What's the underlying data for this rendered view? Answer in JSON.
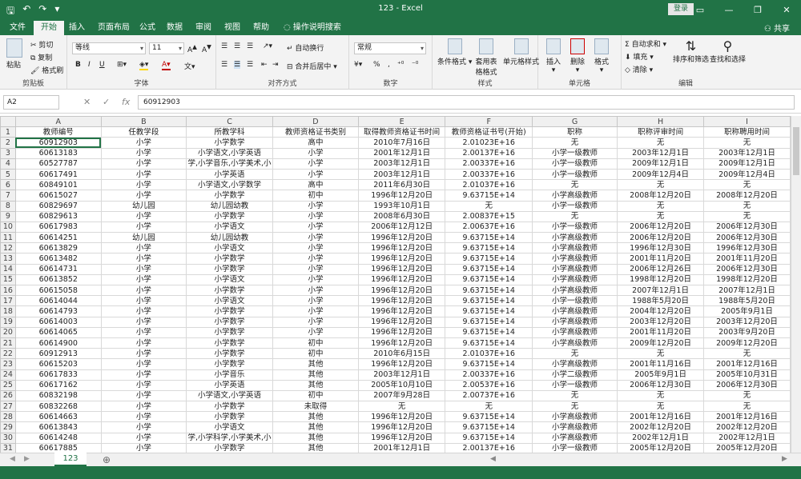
{
  "window": {
    "title": "123  -  Excel",
    "login": "登录",
    "file_tab": "文件"
  },
  "tabs": [
    "开始",
    "插入",
    "页面布局",
    "公式",
    "数据",
    "审阅",
    "视图",
    "帮助",
    "操作说明搜索"
  ],
  "share": "共享",
  "ribbon": {
    "clipboard": {
      "label": "剪贴板",
      "paste": "粘贴",
      "cut": "剪切",
      "copy": "复制",
      "format_painter": "格式刷"
    },
    "font": {
      "label": "字体",
      "name": "等线",
      "size": "11"
    },
    "alignment": {
      "label": "对齐方式",
      "wrap": "自动换行",
      "merge": "合并后居中"
    },
    "number": {
      "label": "数字",
      "format": "常规"
    },
    "styles": {
      "label": "样式",
      "conditional": "条件格式",
      "table_format": "套用表格格式",
      "cell_styles": "单元格样式"
    },
    "cells": {
      "label": "单元格",
      "insert": "插入",
      "delete": "删除",
      "format": "格式"
    },
    "editing": {
      "label": "编辑",
      "autosum": "自动求和",
      "fill": "填充",
      "clear": "清除",
      "sort": "排序和筛选",
      "find": "查找和选择"
    }
  },
  "formula_bar": {
    "name_box": "A2",
    "cancel": "✕",
    "enter": "✓",
    "fx": "fx",
    "value": "60912903"
  },
  "columns": [
    "A",
    "B",
    "C",
    "D",
    "E",
    "F",
    "G",
    "H",
    "I"
  ],
  "rows": [
    [
      "教师编号",
      "任教学段",
      "所教学科",
      "教师资格证书类别",
      "取得教师资格证书时间",
      "教师资格证书号(开始)",
      "职称",
      "职称评审时间",
      "职称聘用时间"
    ],
    [
      "60912903",
      "小学",
      "小学数学",
      "高中",
      "2010年7月16日",
      "2.01023E+16",
      "无",
      "无",
      "无"
    ],
    [
      "60613183",
      "小学",
      "小学语文,小学英语",
      "小学",
      "2001年12月1日",
      "2.00137E+16",
      "小学一级教师",
      "2003年12月1日",
      "2003年12月1日"
    ],
    [
      "60527787",
      "小学",
      "学,小学音乐,小学美术,小",
      "小学",
      "2003年12月1日",
      "2.00337E+16",
      "小学一级教师",
      "2009年12月1日",
      "2009年12月1日"
    ],
    [
      "60617491",
      "小学",
      "小学英语",
      "小学",
      "2003年12月1日",
      "2.00337E+16",
      "小学一级教师",
      "2009年12月4日",
      "2009年12月4日"
    ],
    [
      "60849101",
      "小学",
      "小学语文,小学数学",
      "高中",
      "2011年6月30日",
      "2.01037E+16",
      "无",
      "无",
      "无"
    ],
    [
      "60615027",
      "小学",
      "小学数学",
      "初中",
      "1996年12月20日",
      "9.63715E+14",
      "小学高级教师",
      "2008年12月20日",
      "2008年12月20日"
    ],
    [
      "60829697",
      "幼儿园",
      "幼儿园幼教",
      "小学",
      "1993年10月1日",
      "无",
      "小学一级教师",
      "无",
      "无"
    ],
    [
      "60829613",
      "小学",
      "小学数学",
      "小学",
      "2008年6月30日",
      "2.00837E+15",
      "无",
      "无",
      "无"
    ],
    [
      "60617983",
      "小学",
      "小学语文",
      "小学",
      "2006年12月12日",
      "2.00637E+16",
      "小学一级教师",
      "2006年12月20日",
      "2006年12月30日"
    ],
    [
      "60614251",
      "幼儿园",
      "幼儿园幼教",
      "小学",
      "1996年12月20日",
      "9.63715E+14",
      "小学高级教师",
      "2006年12月20日",
      "2006年12月30日"
    ],
    [
      "60613829",
      "小学",
      "小学语文",
      "小学",
      "1996年12月20日",
      "9.63715E+14",
      "小学高级教师",
      "1996年12月30日",
      "1996年12月30日"
    ],
    [
      "60613482",
      "小学",
      "小学数学",
      "小学",
      "1996年12月20日",
      "9.63715E+14",
      "小学高级教师",
      "2001年11月20日",
      "2001年11月20日"
    ],
    [
      "60614731",
      "小学",
      "小学数学",
      "小学",
      "1996年12月20日",
      "9.63715E+14",
      "小学高级教师",
      "2006年12月26日",
      "2006年12月30日"
    ],
    [
      "60613852",
      "小学",
      "小学语文",
      "小学",
      "1996年12月20日",
      "9.63715E+14",
      "小学高级教师",
      "1998年12月20日",
      "1998年12月20日"
    ],
    [
      "60615058",
      "小学",
      "小学数学",
      "小学",
      "1996年12月20日",
      "9.63715E+14",
      "小学高级教师",
      "2007年12月1日",
      "2007年12月1日"
    ],
    [
      "60614044",
      "小学",
      "小学语文",
      "小学",
      "1996年12月20日",
      "9.63715E+14",
      "小学一级教师",
      "1988年5月20日",
      "1988年5月20日"
    ],
    [
      "60614793",
      "小学",
      "小学数学",
      "小学",
      "1996年12月20日",
      "9.63715E+14",
      "小学高级教师",
      "2004年12月20日",
      "2005年9月1日"
    ],
    [
      "60614003",
      "小学",
      "小学数学",
      "小学",
      "1996年12月20日",
      "9.63715E+14",
      "小学高级教师",
      "2003年12月20日",
      "2003年12月20日"
    ],
    [
      "60614065",
      "小学",
      "小学数学",
      "小学",
      "1996年12月20日",
      "9.63715E+14",
      "小学高级教师",
      "2001年11月20日",
      "2003年9月20日"
    ],
    [
      "60614900",
      "小学",
      "小学数学",
      "初中",
      "1996年12月20日",
      "9.63715E+14",
      "小学高级教师",
      "2009年12月20日",
      "2009年12月20日"
    ],
    [
      "60912913",
      "小学",
      "小学数学",
      "初中",
      "2010年6月15日",
      "2.01037E+16",
      "无",
      "无",
      "无"
    ],
    [
      "60615203",
      "小学",
      "小学数学",
      "其他",
      "1996年12月20日",
      "9.63715E+14",
      "小学高级教师",
      "2001年11月16日",
      "2001年12月16日"
    ],
    [
      "60617833",
      "小学",
      "小学音乐",
      "其他",
      "2003年12月1日",
      "2.00337E+16",
      "小学二级教师",
      "2005年9月1日",
      "2005年10月31日"
    ],
    [
      "60617162",
      "小学",
      "小学英语",
      "其他",
      "2005年10月10日",
      "2.00537E+16",
      "小学一级教师",
      "2006年12月30日",
      "2006年12月30日"
    ],
    [
      "60832198",
      "小学",
      "小学语文,小学英语",
      "初中",
      "2007年9月28日",
      "2.00737E+16",
      "无",
      "无",
      "无"
    ],
    [
      "60832268",
      "小学",
      "小学数学",
      "未取得",
      "无",
      "无",
      "无",
      "无",
      "无"
    ],
    [
      "60614663",
      "小学",
      "小学数学",
      "其他",
      "1996年12月20日",
      "9.63715E+14",
      "小学高级教师",
      "2001年12月16日",
      "2001年12月16日"
    ],
    [
      "60613843",
      "小学",
      "小学语文",
      "其他",
      "1996年12月20日",
      "9.63715E+14",
      "小学高级教师",
      "2002年12月20日",
      "2002年12月20日"
    ],
    [
      "60614248",
      "小学",
      "学,小学科学,小学美术,小",
      "其他",
      "1996年12月20日",
      "9.63715E+14",
      "小学高级教师",
      "2002年12月1日",
      "2002年12月1日"
    ],
    [
      "60617885",
      "小学",
      "小学数学",
      "其他",
      "2001年12月1日",
      "2.00137E+16",
      "小学一级教师",
      "2005年12月20日",
      "2005年12月20日"
    ]
  ],
  "sheet": {
    "name": "123",
    "add": "⊕"
  }
}
